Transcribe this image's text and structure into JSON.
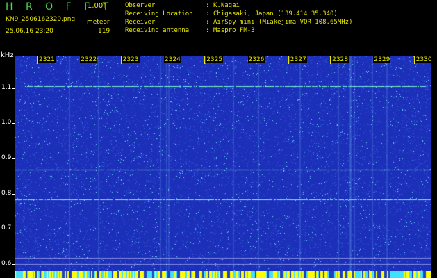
{
  "header": {
    "app_title": "H R O F F T",
    "version": "1.00f",
    "filename": "KN9_2506162320.png",
    "mode": "meteor",
    "datetime": "25.06.16 23:20",
    "count": "119",
    "info": [
      {
        "label": "Observer",
        "value": "K.Nagai"
      },
      {
        "label": "Receiving Location",
        "value": "Chigasaki, Japan (139.414 35.340)"
      },
      {
        "label": "Receiver",
        "value": "AirSpy mini (Miakejima VOR 108.65MHz)"
      },
      {
        "label": "Receiving antenna",
        "value": "Maspro FM-3"
      }
    ]
  },
  "spectrogram": {
    "y_unit": "kHz",
    "y_ticks": [
      "1.1",
      "1.0",
      "0.9",
      "0.8",
      "0.7",
      "0.6"
    ],
    "y_tick_values": [
      1.1,
      1.0,
      0.9,
      0.8,
      0.7,
      0.6
    ],
    "y_range": [
      0.58,
      1.19
    ],
    "time_labels": [
      "2321",
      "2322",
      "2323",
      "2324",
      "2325",
      "2326",
      "2327",
      "2328",
      "2329",
      "2330"
    ],
    "signal_lines_khz": [
      1.105,
      0.868,
      0.783
    ],
    "colors": {
      "background": "#1c2fb8",
      "noise_light": "#6fe0ff",
      "noise_mid": "#3a6af0",
      "signal": "#7fffb0",
      "label": "#e8e800",
      "bar_yellow": "#ffff00",
      "bar_cyan": "#40e0ff"
    }
  }
}
